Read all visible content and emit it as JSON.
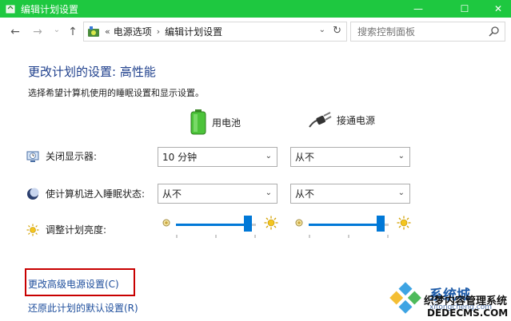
{
  "window": {
    "title": "编辑计划设置",
    "minimize_label": "—",
    "maximize_label": "☐",
    "close_label": "✕"
  },
  "nav": {
    "back_label": "←",
    "forward_label": "→",
    "history_label": "⌄",
    "up_label": "↑",
    "crumb_sep": "«",
    "crumb_1": "电源选项",
    "crumb_chevron": "›",
    "crumb_2": "编辑计划设置",
    "dropdown_label": "⌄",
    "refresh_label": "↻",
    "search_placeholder": "搜索控制面板"
  },
  "main": {
    "heading": "更改计划的设置: 高性能",
    "subheading": "选择希望计算机使用的睡眠设置和显示设置。",
    "col_battery": "用电池",
    "col_ac": "接通电源",
    "rows": [
      {
        "label": "关闭显示器:",
        "battery": "10 分钟",
        "ac": "从不"
      },
      {
        "label": "使计算机进入睡眠状态:",
        "battery": "从不",
        "ac": "从不"
      },
      {
        "label": "调整计划亮度:"
      }
    ],
    "brightness_battery": 0.9,
    "brightness_ac": 0.9,
    "link_advanced": "更改高级电源设置(C)",
    "link_restore": "还原此计划的默认设置(R)"
  },
  "watermark": {
    "brand": "系统城",
    "url": "xitongcheng.com",
    "line2": "织梦内容管理系统",
    "line3": "DEDECMS.COM"
  },
  "colors": {
    "titlebar": "#1ec840",
    "accent": "#0078d7",
    "heading": "#1e3f8c",
    "link": "#1e4e9c",
    "highlight": "#c80000"
  }
}
